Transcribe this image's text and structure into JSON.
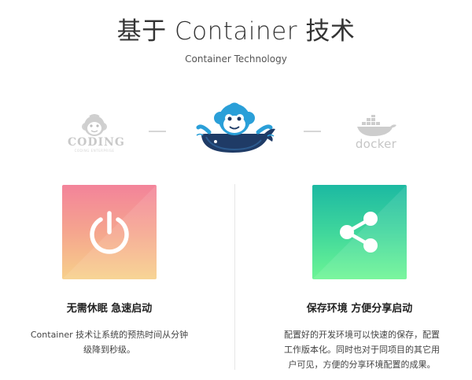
{
  "header": {
    "title": "基于 Container 技术",
    "subtitle": "Container Technology"
  },
  "logos": {
    "coding": {
      "word": "CODING",
      "tagline": "CODING ENTERPRISE",
      "icon": "monkey-head-icon"
    },
    "mascot": {
      "icon": "monkey-riding-whale-icon"
    },
    "docker": {
      "word": "docker",
      "icon": "docker-whale-icon"
    }
  },
  "features": [
    {
      "icon": "power-icon",
      "title": "无需休眠 急速启动",
      "lines": [
        "Container 技术让系统的预热时间从分钟",
        "级降到秒级。"
      ],
      "gradient": [
        "#f3839a",
        "#f7d08a"
      ]
    },
    {
      "icon": "share-icon",
      "title": "保存环境 方便分享启动",
      "lines": [
        "配置好的开发环境可以快速的保存，配置",
        "工作版本化。同时也对于同项目的其它用",
        "户可见，方便的分享环境配置的成果。"
      ],
      "gradient": [
        "#1cb9a2",
        "#6cf594"
      ]
    }
  ],
  "colors": {
    "coding_gray": "#c9c9c9",
    "mascot_blue": "#2a9fd8",
    "whale_navy": "#1f3b66"
  }
}
